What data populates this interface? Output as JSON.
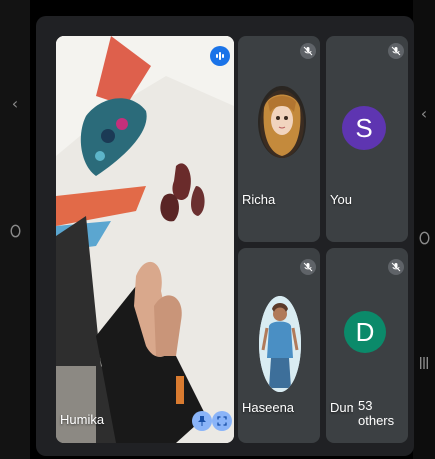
{
  "nav": {
    "back_icon": "chevron-left-icon",
    "home_icon": "circle-home-icon",
    "recents_icon": "recents-bars-icon"
  },
  "main_video": {
    "name": "Humika",
    "pin_icon": "pin-icon",
    "expand_icon": "expand-icon",
    "audio_icon": "audio-active-icon"
  },
  "participants": [
    {
      "name": "Richa",
      "avatar_type": "photo",
      "muted": true
    },
    {
      "name": "You",
      "avatar_type": "letter",
      "letter": "S",
      "color": "#5e35b1",
      "muted": true
    },
    {
      "name": "Haseena",
      "avatar_type": "photo",
      "muted": true
    },
    {
      "name": "Dum",
      "avatar_type": "letter",
      "letter": "D",
      "color": "#0b8a6a",
      "muted": true
    }
  ],
  "others_label": "53 others",
  "colors": {
    "accent": "#1a73e8",
    "tile": "#3c4043",
    "background": "#202124"
  }
}
